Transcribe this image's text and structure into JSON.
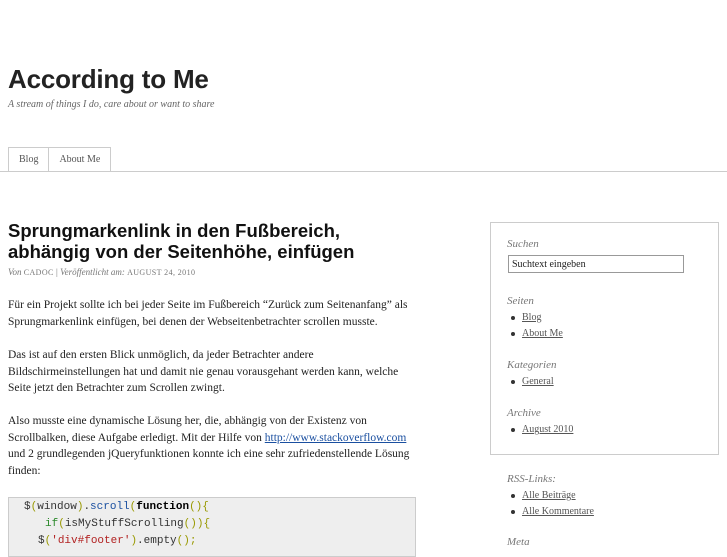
{
  "site": {
    "title": "According to Me",
    "description": "A stream of things I do, care about or want to share"
  },
  "nav": {
    "tabs": [
      {
        "label": "Blog"
      },
      {
        "label": "About Me"
      }
    ]
  },
  "post": {
    "title": "Sprungmarkenlink in den Fußbereich, abhängig von der Seitenhöhe, einfügen",
    "meta": {
      "by_label": "Von",
      "author": "CADOC",
      "separator": "|",
      "published_label": "Veröffentlicht am:",
      "date": "August 24, 2010"
    },
    "paragraphs": {
      "p1": "Für ein Projekt sollte ich bei jeder Seite im Fußbereich “Zurück zum Seitenanfang” als Sprungmarkenlink einfügen, bei denen der Webseitenbetrachter scrollen musste.",
      "p2": "Das ist auf den ersten Blick unmöglich, da jeder Betrachter andere Bildschirmeinstellungen hat und damit nie genau vorausgehant werden kann, welche Seite jetzt den Betrachter zum Scrollen zwingt.",
      "p3_before": "Also musste eine dynamische Lösung her, die, abhängig von der Existenz von Scrollbalken, diese Aufgabe erledigt. Mit der Hilfe von ",
      "p3_link": "http://www.stackoverflow.com",
      "p3_after": " und 2 grundlegenden jQueryfunktionen konnte ich eine sehr zufriedenstellende Lösung finden:"
    },
    "code": {
      "line1": {
        "dollar": "$",
        "p1": "(",
        "obj": "window",
        "p2": ")",
        "dot": ".",
        "fn": "scroll",
        "p3": "(",
        "kw": "function",
        "p4": "(){"
      },
      "line2": {
        "kw": "if",
        "p1": "(",
        "fn": "isMyStuffScrolling",
        "p2": "()){"
      },
      "line3": {
        "dollar": "$",
        "p1": "(",
        "str": "'div#footer'",
        "p2": ")",
        "rest": ".empty",
        "p3": "();"
      }
    }
  },
  "sidebar": {
    "search": {
      "title": "Suchen",
      "value": "Suchtext eingeben"
    },
    "pages": {
      "title": "Seiten",
      "items": [
        "Blog",
        "About Me"
      ]
    },
    "categories": {
      "title": "Kategorien",
      "items": [
        "General"
      ]
    },
    "archive": {
      "title": "Archive",
      "items": [
        "August 2010"
      ]
    },
    "rss": {
      "title": "RSS-Links:",
      "items": [
        "Alle Beiträge",
        "Alle Kommentare"
      ]
    },
    "meta": {
      "title": "Meta"
    }
  }
}
